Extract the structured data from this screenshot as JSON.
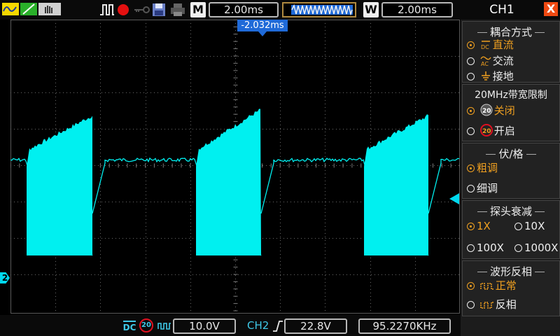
{
  "toolbar": {
    "mode_letter": "M",
    "timebase": "2.00ms",
    "window_letter": "W",
    "window_time": "2.00ms"
  },
  "trigger": {
    "position_label": "-2.032ms"
  },
  "channel_marker": {
    "label": "2"
  },
  "status": {
    "coupling": "DC",
    "bw_limit": "20",
    "volts_div": "10.0V",
    "trigger_source": "CH2",
    "trigger_level": "22.8V",
    "frequency": "95.2270KHz"
  },
  "panel": {
    "title": "CH1",
    "close_label": "X",
    "coupling": {
      "title": "耦合方式",
      "options": [
        {
          "icon_text": "DC",
          "label": "直流",
          "selected": true
        },
        {
          "icon_text": "AC",
          "label": "交流",
          "selected": false
        },
        {
          "icon_text": "",
          "label": "接地",
          "selected": false
        }
      ]
    },
    "bandwidth": {
      "title": "20MHz带宽限制",
      "options": [
        {
          "icon_text": "20",
          "label": "关闭",
          "selected": true
        },
        {
          "icon_text": "20",
          "label": "开启",
          "selected": false
        }
      ]
    },
    "volts": {
      "title": "伏/格",
      "options": [
        {
          "label": "粗调",
          "selected": true
        },
        {
          "label": "细调",
          "selected": false
        }
      ]
    },
    "probe": {
      "title": "探头衰减",
      "options": [
        {
          "label": "1X",
          "selected": true
        },
        {
          "label": "10X",
          "selected": false
        },
        {
          "label": "100X",
          "selected": false
        },
        {
          "label": "1000X",
          "selected": false
        }
      ]
    },
    "invert": {
      "title": "波形反相",
      "options": [
        {
          "label": "正常",
          "selected": true
        },
        {
          "label": "反相",
          "selected": false
        }
      ]
    }
  },
  "colors": {
    "trace": "#00f0f0",
    "selected": "#f0a020",
    "accent_blue": "#1f6ad8",
    "close": "#f04a12"
  }
}
